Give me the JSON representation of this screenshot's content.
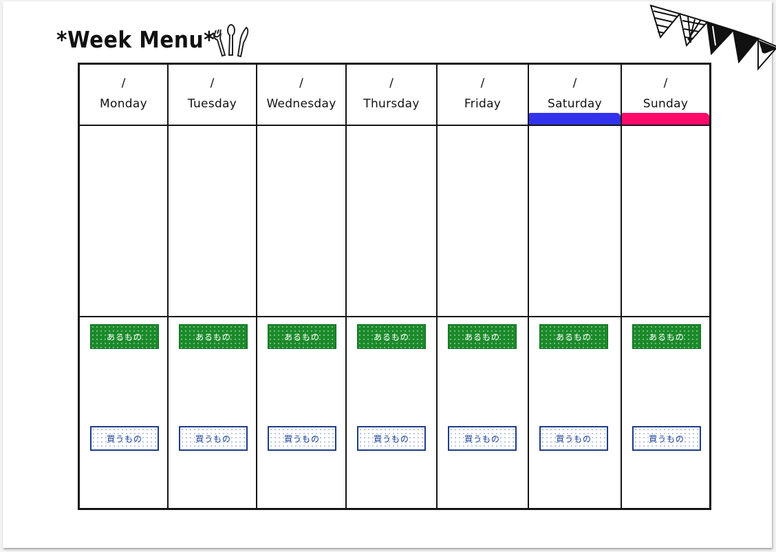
{
  "title": "*Week Menu*",
  "icons": {
    "cutlery": "fork-spoon-knife-icon",
    "decoration": "bunting-flags-icon"
  },
  "colors": {
    "saturday_band": "#3333ee",
    "sunday_band": "#ff0a6a",
    "have_tag": "#1b8a2a",
    "buy_tag_border": "#1d3c85"
  },
  "days": [
    {
      "date": "/",
      "name": "Monday",
      "have_label": "あるもの",
      "buy_label": "買うもの"
    },
    {
      "date": "/",
      "name": "Tuesday",
      "have_label": "あるもの",
      "buy_label": "買うもの"
    },
    {
      "date": "/",
      "name": "Wednesday",
      "have_label": "あるもの",
      "buy_label": "買うもの"
    },
    {
      "date": "/",
      "name": "Thursday",
      "have_label": "あるもの",
      "buy_label": "買うもの"
    },
    {
      "date": "/",
      "name": "Friday",
      "have_label": "あるもの",
      "buy_label": "買うもの"
    },
    {
      "date": "/",
      "name": "Saturday",
      "have_label": "あるもの",
      "buy_label": "買うもの"
    },
    {
      "date": "/",
      "name": "Sunday",
      "have_label": "あるもの",
      "buy_label": "買うもの"
    }
  ]
}
